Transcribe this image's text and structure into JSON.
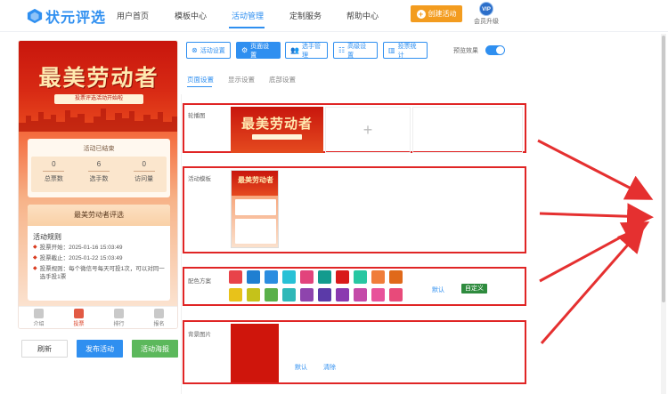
{
  "brand": {
    "name": "状元评选"
  },
  "nav": {
    "items": [
      "用户首页",
      "模板中心",
      "活动管理",
      "定制服务",
      "帮助中心"
    ],
    "create_button": "创建活动",
    "vip_badge": "VIP",
    "vip_label": "会员升级"
  },
  "preview": {
    "banner_title": "最美劳动者",
    "banner_subtitle": "投票评选活动开始啦",
    "status": "活动已结束",
    "stats": [
      {
        "value": "0",
        "label": "总票数"
      },
      {
        "value": "6",
        "label": "选手数"
      },
      {
        "value": "0",
        "label": "访问量"
      }
    ],
    "event_title": "最美劳动者评选",
    "rules_title": "活动规则",
    "rules": [
      "投票开始：2025-01-16 15:03:49",
      "投票截止：2025-01-22 15:03:49",
      "投票规则：每个微信号每天可投1次，可以对同一选手投1票"
    ],
    "tabs": [
      "介绍",
      "投票",
      "排行",
      "报名"
    ]
  },
  "actions": {
    "refresh": "刷新",
    "publish": "发布活动",
    "poster": "活动海报"
  },
  "toolbar": {
    "buttons": [
      "活动设置",
      "页面设置",
      "选手管理",
      "高级设置",
      "投票统计"
    ],
    "preview_label": "预览效果",
    "preview_on": true
  },
  "subtabs": [
    "页面设置",
    "显示设置",
    "底部设置"
  ],
  "sections": {
    "carousel_label": "轮播图",
    "carousel_add": "+",
    "template_label": "活动模板",
    "color_label": "配色方案",
    "color_default": "默认",
    "color_custom": "自定义",
    "bg_label": "背景图片",
    "bg_default": "默认",
    "bg_clear": "清除"
  },
  "colors": {
    "accent": "#2f8ff0",
    "highlight_border": "#e02525",
    "swatches_row1": [
      "#e8434a",
      "#1f7fd1",
      "#2a8de0",
      "#27c1d6",
      "#e2447c",
      "#139b8e",
      "#d91a1a",
      "#27c7a2",
      "#f07d3a",
      "#e0691a"
    ],
    "swatches_row2": [
      "#e8c21a",
      "#c5c21a",
      "#5ab04a",
      "#2fb8b8",
      "#8e44ad",
      "#5b3aa8",
      "#8a3ab0",
      "#c44aa8",
      "#e8529a",
      "#e84a7a"
    ]
  }
}
